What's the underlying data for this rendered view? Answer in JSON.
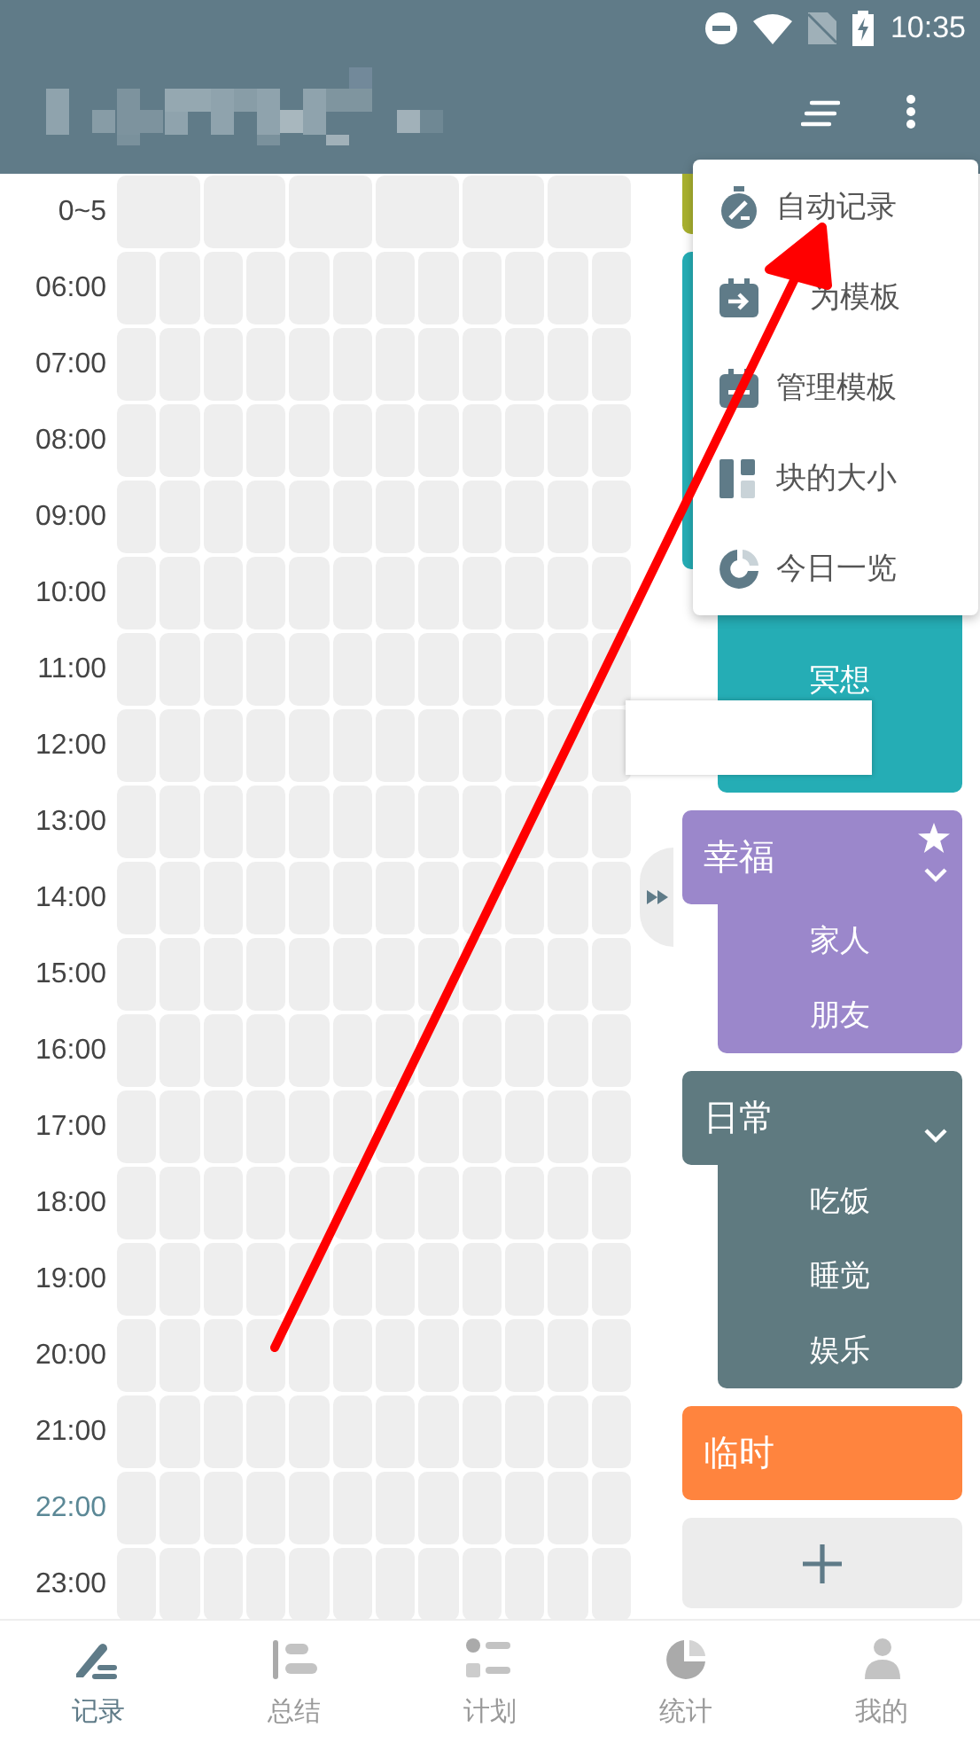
{
  "status_bar": {
    "time": "10:35"
  },
  "time_rows": [
    {
      "label": "0~5",
      "kind": "range",
      "current": false
    },
    {
      "label": "06:00",
      "kind": "hour",
      "current": false
    },
    {
      "label": "07:00",
      "kind": "hour",
      "current": false
    },
    {
      "label": "08:00",
      "kind": "hour",
      "current": false
    },
    {
      "label": "09:00",
      "kind": "hour",
      "current": false
    },
    {
      "label": "10:00",
      "kind": "hour",
      "current": false
    },
    {
      "label": "11:00",
      "kind": "hour",
      "current": false
    },
    {
      "label": "12:00",
      "kind": "hour",
      "current": false
    },
    {
      "label": "13:00",
      "kind": "hour",
      "current": false
    },
    {
      "label": "14:00",
      "kind": "hour",
      "current": false
    },
    {
      "label": "15:00",
      "kind": "hour",
      "current": false
    },
    {
      "label": "16:00",
      "kind": "hour",
      "current": false
    },
    {
      "label": "17:00",
      "kind": "hour",
      "current": false
    },
    {
      "label": "18:00",
      "kind": "hour",
      "current": false
    },
    {
      "label": "19:00",
      "kind": "hour",
      "current": false
    },
    {
      "label": "20:00",
      "kind": "hour",
      "current": false
    },
    {
      "label": "21:00",
      "kind": "hour",
      "current": false
    },
    {
      "label": "22:00",
      "kind": "hour",
      "current": true
    },
    {
      "label": "23:00",
      "kind": "hour",
      "current": false
    }
  ],
  "categories": [
    {
      "color": "#a9b12f"
    },
    {
      "color": "#25adb5",
      "items": [
        "冥想"
      ]
    },
    {
      "name": "幸福",
      "color": "#9b87cb",
      "starred": true,
      "chevron": true,
      "items": [
        "家人",
        "朋友"
      ]
    },
    {
      "name": "日常",
      "color": "#5f7a80",
      "starred": false,
      "chevron": true,
      "items": [
        "吃饭",
        "睡觉",
        "娱乐"
      ]
    },
    {
      "name": "临时",
      "color": "#ff843e",
      "starred": false,
      "chevron": false
    }
  ],
  "menu": {
    "items": [
      {
        "label": "自动记录"
      },
      {
        "label": "为模板"
      },
      {
        "label": "管理模板"
      },
      {
        "label": "块的大小"
      },
      {
        "label": "今日一览"
      }
    ]
  },
  "bottom_nav": [
    {
      "label": "记录",
      "selected": true
    },
    {
      "label": "总结",
      "selected": false
    },
    {
      "label": "计划",
      "selected": false
    },
    {
      "label": "统计",
      "selected": false
    },
    {
      "label": "我的",
      "selected": false
    }
  ]
}
